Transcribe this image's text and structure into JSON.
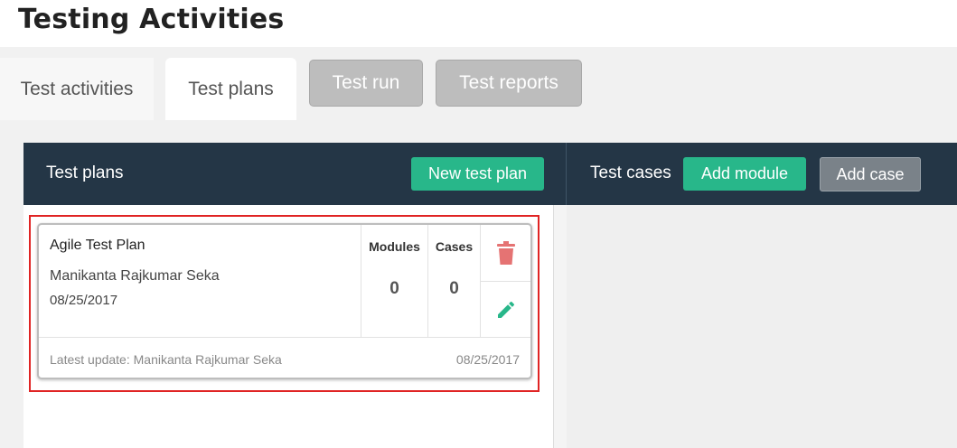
{
  "page": {
    "title": "Testing Activities"
  },
  "tabs": [
    {
      "label": "Test activities",
      "state": "inactive"
    },
    {
      "label": "Test plans",
      "state": "active"
    },
    {
      "label": "Test run",
      "state": "disabled"
    },
    {
      "label": "Test reports",
      "state": "disabled"
    }
  ],
  "test_plans_panel": {
    "title": "Test plans",
    "new_button_label": "New test plan",
    "plans": [
      {
        "name": "Agile Test Plan",
        "author": "Manikanta Rajkumar Seka",
        "date": "08/25/2017",
        "modules_label": "Modules",
        "modules_count": "0",
        "cases_label": "Cases",
        "cases_count": "0",
        "latest_update": "Latest update: Manikanta Rajkumar Seka",
        "latest_update_date": "08/25/2017",
        "delete_icon": "trash-icon",
        "edit_icon": "pencil-icon"
      }
    ]
  },
  "test_cases_panel": {
    "title": "Test cases",
    "add_module_label": "Add module",
    "add_case_label": "Add case"
  },
  "colors": {
    "header_bg": "#243646",
    "accent_green": "#28b78a",
    "delete_red": "#e57373",
    "highlight_red": "#e02424",
    "disabled_tab": "#bdbdbd",
    "disabled_button": "#7a8289"
  }
}
